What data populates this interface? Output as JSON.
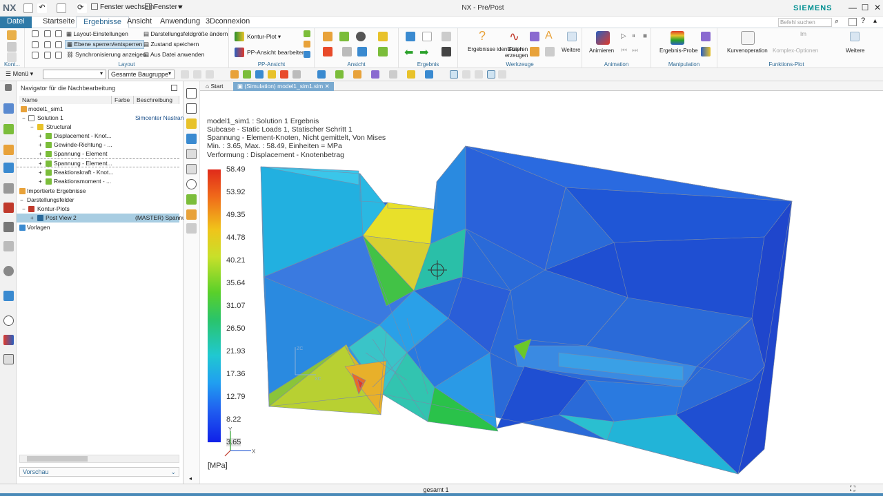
{
  "titlebar": {
    "logo": "NX",
    "switch_window": "Fenster wechseln",
    "window_menu": "Fenster",
    "title": "NX - Pre/Post",
    "brand": "SIEMENS"
  },
  "tabs": [
    "Datei",
    "Startseite",
    "Ergebnisse",
    "Ansicht",
    "Anwendung",
    "3Dconnexion"
  ],
  "active_tab": "Ergebnisse",
  "search_placeholder": "Befehl suchen",
  "ribbon": {
    "group_labels": [
      "Kont...",
      "Layout",
      "PP-Ansicht",
      "Ansicht",
      "Ergebnis",
      "Werkzeuge",
      "Animation",
      "Manipulation",
      "Funktions-Plot"
    ],
    "layout_items": [
      "Layout-Einstellungen",
      "Ebene sperren/entsperren",
      "Synchronisierung anzeigen",
      "Darstellungsfeldgröße ändern",
      "Zustand speichern",
      "Aus Datei anwenden"
    ],
    "pp_items": [
      "Kontur-Plot",
      "PP-Ansicht bearbeiten"
    ],
    "werkzeuge_items": [
      "Ergebnisse identifizieren",
      "Graph erzeugen",
      "Weitere"
    ],
    "animation_items": [
      "Animieren"
    ],
    "manipulation_items": [
      "Ergebnis-Probe"
    ],
    "funktion_items": [
      "Kurvenoperation",
      "Komplex-Optionen",
      "Weitere"
    ]
  },
  "toolbar2": {
    "menu": "Menü",
    "filter_value": "",
    "scope_value": "Gesamte Baugruppe"
  },
  "navigator": {
    "title": "Navigator für die Nachbearbeitung",
    "columns": [
      "Name",
      "Farbe",
      "Beschreibung"
    ],
    "rows": [
      {
        "name": "model1_sim1",
        "desc": ""
      },
      {
        "name": "Solution 1",
        "desc": "Simcenter Nastran"
      },
      {
        "name": "Structural",
        "desc": ""
      },
      {
        "name": "Displacement - Knot...",
        "desc": ""
      },
      {
        "name": "Gewinde-Richtung - ...",
        "desc": ""
      },
      {
        "name": "Spannung - Element",
        "desc": ""
      },
      {
        "name": "Spannung - Element...",
        "desc": ""
      },
      {
        "name": "Reaktionskraft - Knot...",
        "desc": ""
      },
      {
        "name": "Reaktionsmoment - ...",
        "desc": ""
      },
      {
        "name": "Importierte Ergebnisse",
        "desc": ""
      },
      {
        "name": "Darstellungsfelder",
        "desc": ""
      },
      {
        "name": "Kontur-Plots",
        "desc": ""
      },
      {
        "name": "Post View 2",
        "desc": "(MASTER) Spannu..."
      },
      {
        "name": "Vorlagen",
        "desc": ""
      }
    ],
    "preview": "Vorschau"
  },
  "doc_tabs": [
    "Start",
    "(Simulation) model1_sim1.sim"
  ],
  "viewport": {
    "info_lines": [
      "model1_sim1 : Solution 1 Ergebnis",
      "Subcase - Static Loads 1, Statischer Schritt 1",
      "Spannung - Element-Knoten, Nicht gemittelt, Von Mises",
      "Min. : 3.65, Max. : 58.49, Einheiten = MPa",
      "Verformung : Displacement - Knotenbetrag"
    ],
    "legend_values": [
      "58.49",
      "53.92",
      "49.35",
      "44.78",
      "40.21",
      "35.64",
      "31.07",
      "26.50",
      "21.93",
      "17.36",
      "12.79",
      "8.22",
      "3.65"
    ],
    "unit": "[MPa]",
    "triad_labels": [
      "XC",
      "YC",
      "ZC",
      "X",
      "Y"
    ]
  },
  "status": "gesamt 1"
}
